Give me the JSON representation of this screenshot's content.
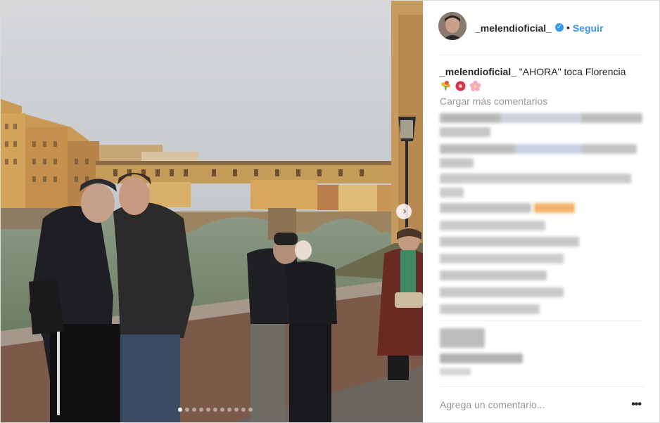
{
  "post": {
    "carousel_dots_total": 11,
    "carousel_active_index": 0,
    "next_icon": "chevron-right-icon"
  },
  "header": {
    "username": "_melendioficial_",
    "verified_icon": "verified-badge-icon",
    "separator": "•",
    "follow_label": "Seguir",
    "follow_color": "#3897f0"
  },
  "caption": {
    "username": "_melendioficial_",
    "text": "\"AHORA\" toca Florencia",
    "emoji_icons": [
      "bouquet-icon",
      "hibiscus-icon",
      "cherry-blossom-icon"
    ]
  },
  "comments": {
    "load_more_label": "Cargar más comentarios"
  },
  "composer": {
    "placeholder": "Agrega un comentario...",
    "more_label": "•••"
  }
}
